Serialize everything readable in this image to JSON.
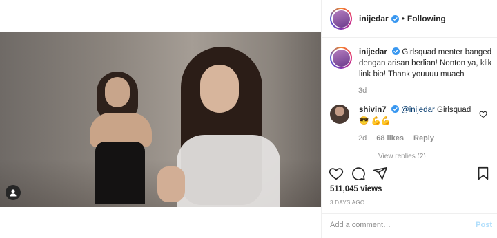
{
  "header": {
    "username": "inijedar",
    "separator": "•",
    "follow_state": "Following"
  },
  "caption": {
    "username": "inijedar",
    "text": "Girlsquad menter banged dengan arisan berlian! Nonton ya, klik link bio! Thank youuuu muach",
    "age": "3d"
  },
  "comment": {
    "username": "shivin7",
    "mention": "@inijedar",
    "text": " Girlsquad 😎 💪💪",
    "age": "2d",
    "likes": "68 likes",
    "reply": "Reply",
    "view_replies": "View replies (2)"
  },
  "stats": {
    "views": "511,045 views",
    "date": "3 DAYS AGO"
  },
  "composer": {
    "placeholder": "Add a comment…",
    "post_label": "Post"
  },
  "colors": {
    "verified": "#3897f0",
    "link": "#00376b",
    "post_disabled": "#b2dffc"
  }
}
